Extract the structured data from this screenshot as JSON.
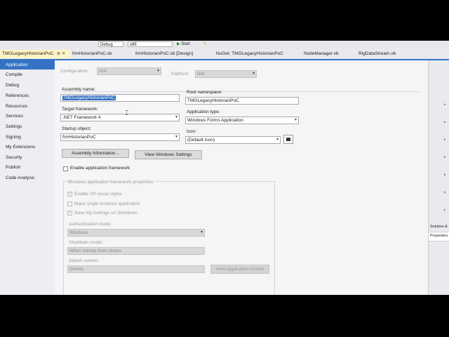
{
  "toolbar": {
    "config_combo": "Debug",
    "platform_combo": "x86",
    "start_label": "Start"
  },
  "tabs": [
    {
      "label": "TMGLegacyHistorianPoC",
      "active": true
    },
    {
      "label": "frmHistorianPoC.vb"
    },
    {
      "label": "frmHistorianPoC.vb [Design]"
    },
    {
      "label": "NuGet: TMGLegacyHistorianPoC"
    },
    {
      "label": "NodeManager.vb"
    },
    {
      "label": "RigDataStream.vb"
    }
  ],
  "nav": [
    "Application",
    "Compile",
    "Debug",
    "References",
    "Resources",
    "Services",
    "Settings",
    "Signing",
    "My Extensions",
    "Security",
    "Publish",
    "Code Analysis"
  ],
  "main": {
    "configuration_label": "Configuration:",
    "configuration_value": "N/A",
    "platform_label": "Platform:",
    "platform_value": "N/A",
    "assembly_name_label": "Assembly name:",
    "assembly_name_value": "TMGLegacyHistorianPoC",
    "root_namespace_label": "Root namespace:",
    "root_namespace_value": "TMGLegacyHistorianPoC",
    "target_framework_label": "Target framework:",
    "target_framework_value": ".NET Framework 4",
    "application_type_label": "Application type:",
    "application_type_value": "Windows Forms Application",
    "startup_object_label": "Startup object:",
    "startup_object_value": "frmHistorianPoC",
    "icon_label": "Icon:",
    "icon_value": "(Default Icon)",
    "assembly_info_button": "Assembly Information...",
    "view_windows_settings_button": "View Windows Settings",
    "enable_app_framework_label": "Enable application framework",
    "group_title": "Windows application framework properties",
    "enable_xp_styles_label": "Enable XP visual styles",
    "single_instance_label": "Make single instance application",
    "save_settings_label": "Save My.Settings on Shutdown",
    "auth_mode_label": "Authentication mode:",
    "auth_mode_value": "Windows",
    "shutdown_mode_label": "Shutdown mode:",
    "shutdown_mode_value": "When startup form closes",
    "splash_screen_label": "Splash screen:",
    "splash_screen_value": "(None)",
    "view_app_events_button": "View Application Events"
  },
  "right_panel": {
    "solution_label": "Solution E",
    "properties_label": "Properties"
  }
}
